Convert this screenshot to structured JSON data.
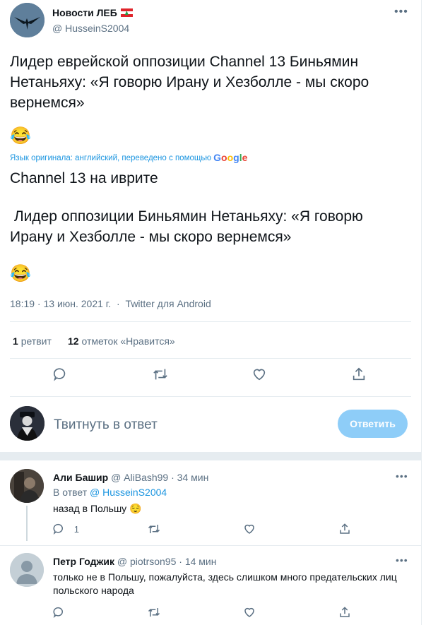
{
  "tweet": {
    "author_name": "Новости ЛЕБ",
    "author_handle": "@ HusseinS2004",
    "more": "•••",
    "text_translated": "Лидер еврейской оппозиции Channel 13 Биньямин Нетаньяху: «Я говорю Ирану и Хезболле - мы скоро вернемся»",
    "emoji1": "😂",
    "translation_note": "Язык оригинала: английский, переведено с помощью",
    "translation_provider": "Google",
    "text_original_line1": "Channel 13 на иврите",
    "text_original_line2": " Лидер оппозиции Биньямин Нетаньяху: «Я говорю Ирану и Хезболле - мы скоро вернемся»",
    "emoji2": "😂",
    "time": "18:19 · 13 июн. 2021 г.",
    "dot": "·",
    "source": "Twitter для Android",
    "retweet_count": "1",
    "retweet_label": "ретвит",
    "like_count": "12",
    "like_label": "отметок «Нравится»"
  },
  "reply_box": {
    "placeholder": "Твитнуть в ответ",
    "button": "Ответить"
  },
  "comments": [
    {
      "name": "Али Башир",
      "handle": "@ AliBash99",
      "time": "· 34 мин",
      "reply_to_prefix": "В ответ",
      "reply_to": "@ HusseinS2004",
      "text": "назад в Польшу 😌",
      "reply_count": "1",
      "more": "•••"
    },
    {
      "name": "Петр Годжик",
      "handle": "@ piotrson95",
      "time": "· 14 мин",
      "text": "только не в Польшу, пожалуйста, здесь слишком много предательских лиц польского народа",
      "more": "•••"
    }
  ],
  "icons": {
    "reply": "reply-icon",
    "retweet": "retweet-icon",
    "like": "like-icon",
    "share": "share-icon"
  },
  "colors": {
    "accent": "#1b95e0",
    "button_disabled": "#8ecdf8",
    "muted": "#5b7083"
  }
}
